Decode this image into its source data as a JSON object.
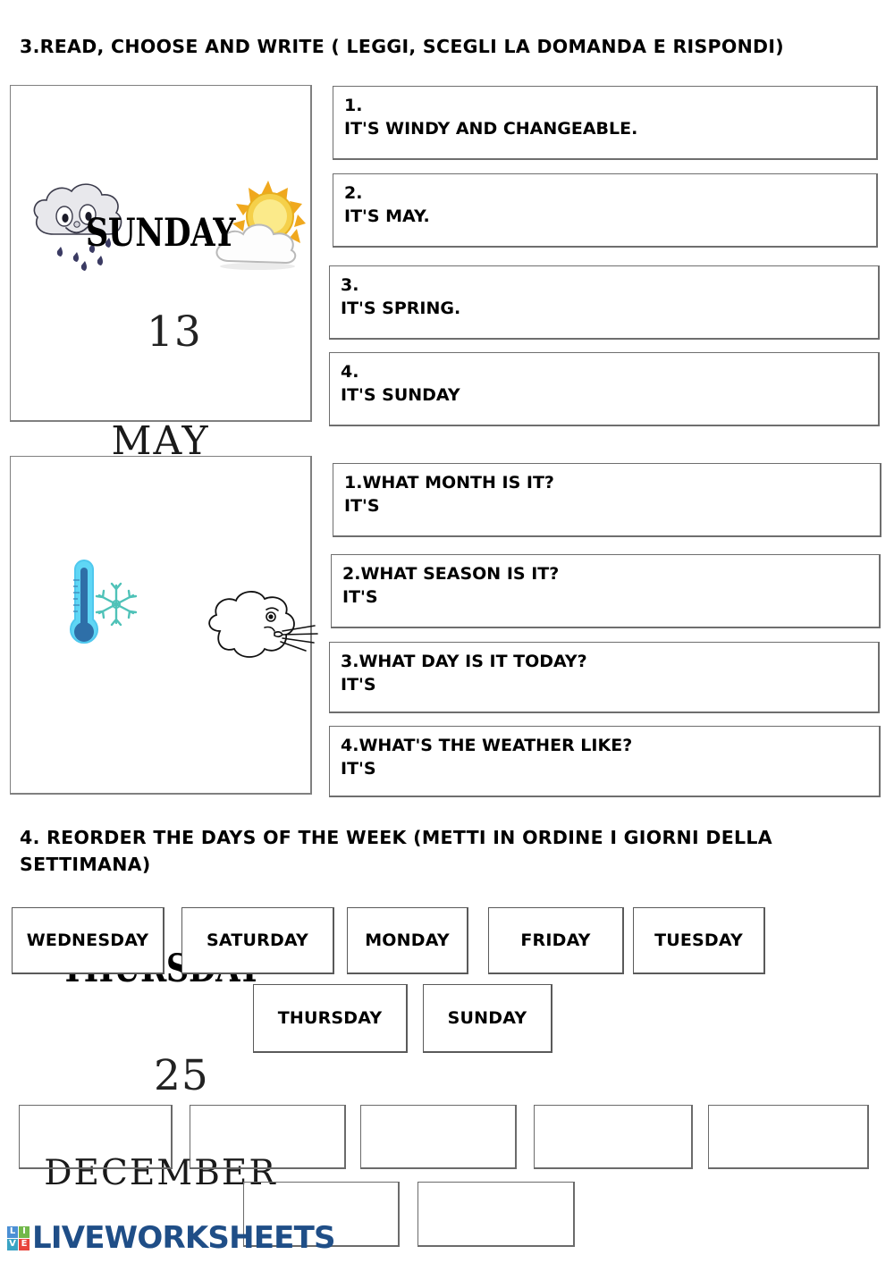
{
  "exercise3": {
    "heading": "3.READ, CHOOSE AND WRITE ( LEGGI, SCEGLI LA DOMANDA E RISPONDI)",
    "card1": {
      "day": "SUNDAY",
      "date": "13",
      "month": "MAY",
      "icon_left": "rain-cloud-face-icon",
      "icon_right": "sun-behind-cloud-icon"
    },
    "card2": {
      "day": "THURSDAY",
      "date": "25",
      "month": "DECEMBER",
      "icon_left": "cold-thermometer-snowflake-icon",
      "icon_right": "wind-blowing-cloud-face-icon"
    },
    "answers": [
      {
        "number": "1.",
        "text": "IT'S WINDY AND CHANGEABLE."
      },
      {
        "number": "2.",
        "text": "IT'S MAY."
      },
      {
        "number": "3.",
        "text": "IT'S SPRING."
      },
      {
        "number": "4.",
        "text": "IT'S SUNDAY"
      }
    ],
    "questions": [
      {
        "question": "1.WHAT MONTH IS IT?",
        "answer": "IT'S"
      },
      {
        "question": " 2.WHAT SEASON IS IT?",
        "answer": "IT'S"
      },
      {
        "question": "3.WHAT DAY IS IT TODAY?",
        "answer": "IT'S"
      },
      {
        "question": "4.WHAT'S THE WEATHER LIKE?",
        "answer": "IT'S"
      }
    ]
  },
  "exercise4": {
    "heading": "4. REORDER THE DAYS OF THE WEEK (METTI IN ORDINE I GIORNI DELLA SETTIMANA)",
    "word_tiles_row1": [
      "WEDNESDAY",
      "SATURDAY",
      "MONDAY",
      "FRIDAY",
      "TUESDAY"
    ],
    "word_tiles_row2": [
      "THURSDAY",
      "SUNDAY"
    ],
    "drop_boxes_row1_count": 5,
    "drop_boxes_row2_count": 2
  },
  "footer": {
    "logo_tiles": [
      "L",
      "I",
      "V",
      "E"
    ],
    "logo_text": "LIVEWORKSHEETS",
    "logo_color": "#1f4e87"
  }
}
